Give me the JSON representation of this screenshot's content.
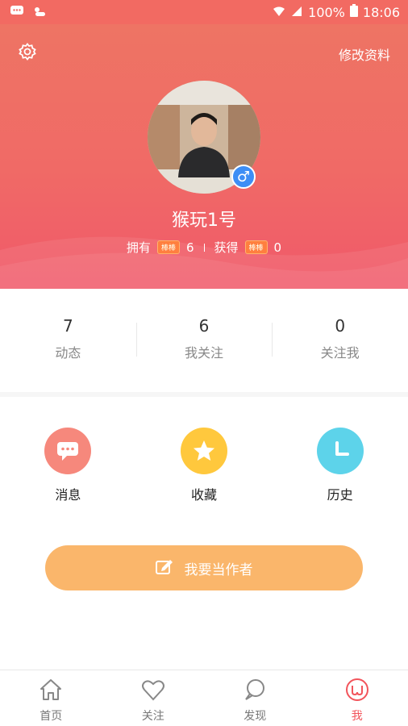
{
  "status_bar": {
    "battery": "100%",
    "time": "18:06",
    "icons": [
      "message-icon",
      "weather-icon",
      "wifi-icon",
      "signal-icon",
      "battery-icon"
    ]
  },
  "header": {
    "edit_label": "修改资料",
    "nickname": "猴玩1号",
    "own_label": "拥有",
    "own_tag": "棒棒",
    "own_count": "6",
    "gain_label": "获得",
    "gain_tag": "棒棒",
    "gain_count": "0",
    "gender_symbol": "♂"
  },
  "counts": [
    {
      "num": "7",
      "label": "动态"
    },
    {
      "num": "6",
      "label": "我关注"
    },
    {
      "num": "0",
      "label": "关注我"
    }
  ],
  "quick": [
    {
      "label": "消息",
      "color": "#f6887c",
      "icon": "message-bubble-icon"
    },
    {
      "label": "收藏",
      "color": "#ffc83d",
      "icon": "star-icon"
    },
    {
      "label": "历史",
      "color": "#5dd3ea",
      "icon": "clock-icon"
    }
  ],
  "author_button": "我要当作者",
  "tabs": [
    {
      "label": "首页",
      "icon": "home-icon"
    },
    {
      "label": "关注",
      "icon": "heart-icon"
    },
    {
      "label": "发现",
      "icon": "discover-icon"
    },
    {
      "label": "我",
      "icon": "me-icon",
      "active": true
    }
  ],
  "colors": {
    "accent": "#f2545b",
    "header": "#ef6a66",
    "author_button": "#fab66b"
  }
}
